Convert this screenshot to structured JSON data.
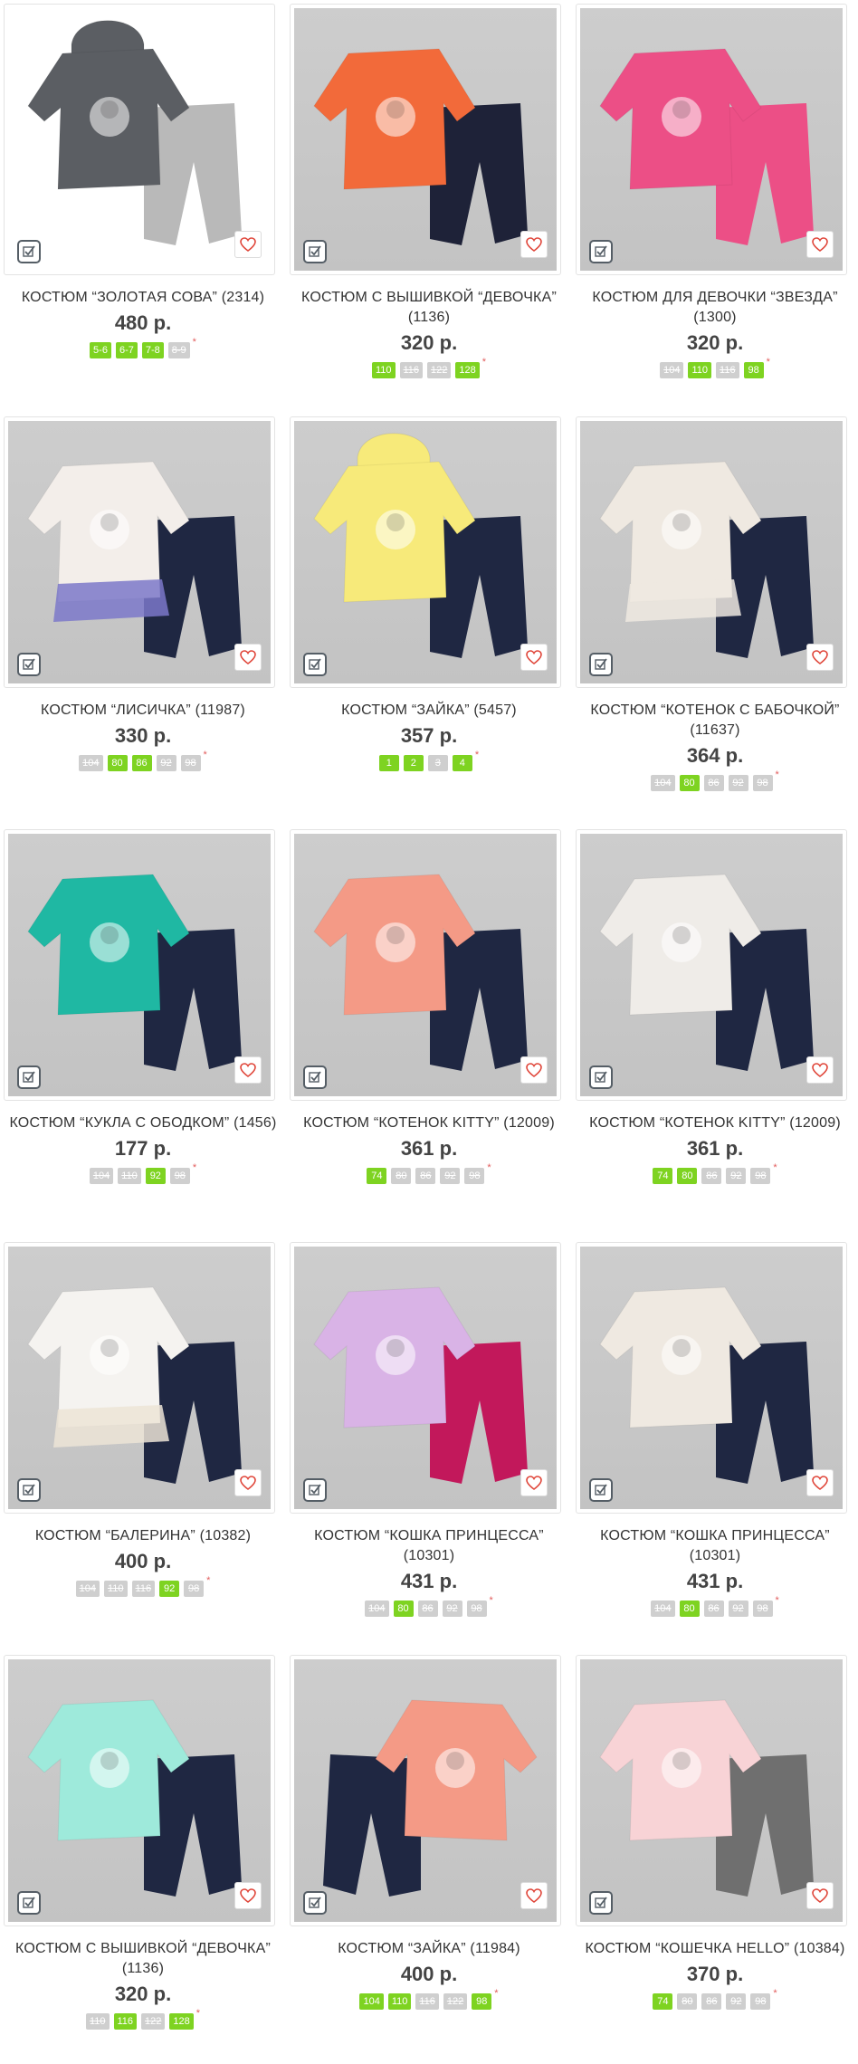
{
  "colors": {
    "accent_green": "#7ed321",
    "size_unavailable": "#cfcfcf",
    "heart": "#e0463a"
  },
  "icons": {
    "compare": "checkbox-check-icon",
    "favorite": "heart-icon"
  },
  "products": [
    {
      "title": "КОСТЮМ “ЗОЛОТАЯ СОВА” (2314)",
      "price": "480 р.",
      "sizes": [
        {
          "label": "5-6",
          "on": true
        },
        {
          "label": "6-7",
          "on": true
        },
        {
          "label": "7-8",
          "on": true
        },
        {
          "label": "8-9",
          "on": false
        }
      ]
    },
    {
      "title": "КОСТЮМ С ВЫШИВКОЙ “ДЕВОЧКА” (1136)",
      "price": "320 р.",
      "sizes": [
        {
          "label": "110",
          "on": true
        },
        {
          "label": "116",
          "on": false
        },
        {
          "label": "122",
          "on": false
        },
        {
          "label": "128",
          "on": true
        }
      ]
    },
    {
      "title": "КОСТЮМ ДЛЯ ДЕВОЧКИ “ЗВЕЗДА” (1300)",
      "price": "320 р.",
      "sizes": [
        {
          "label": "104",
          "on": false
        },
        {
          "label": "110",
          "on": true
        },
        {
          "label": "116",
          "on": false
        },
        {
          "label": "98",
          "on": true
        }
      ]
    },
    {
      "title": "КОСТЮМ “ЛИСИЧКА” (11987)",
      "price": "330 р.",
      "sizes": [
        {
          "label": "104",
          "on": false
        },
        {
          "label": "80",
          "on": true
        },
        {
          "label": "86",
          "on": true
        },
        {
          "label": "92",
          "on": false
        },
        {
          "label": "98",
          "on": false
        }
      ]
    },
    {
      "title": "КОСТЮМ “ЗАЙКА” (5457)",
      "price": "357 р.",
      "sizes": [
        {
          "label": "1",
          "on": true
        },
        {
          "label": "2",
          "on": true
        },
        {
          "label": "3",
          "on": false
        },
        {
          "label": "4",
          "on": true
        }
      ]
    },
    {
      "title": "КОСТЮМ “КОТЕНОК С БАБОЧКОЙ” (11637)",
      "price": "364 р.",
      "sizes": [
        {
          "label": "104",
          "on": false
        },
        {
          "label": "80",
          "on": true
        },
        {
          "label": "86",
          "on": false
        },
        {
          "label": "92",
          "on": false
        },
        {
          "label": "98",
          "on": false
        }
      ]
    },
    {
      "title": "КОСТЮМ “КУКЛА С ОБОДКОМ” (1456)",
      "price": "177 р.",
      "sizes": [
        {
          "label": "104",
          "on": false
        },
        {
          "label": "110",
          "on": false
        },
        {
          "label": "92",
          "on": true
        },
        {
          "label": "98",
          "on": false
        }
      ]
    },
    {
      "title": "КОСТЮМ “КОТЕНОК KITTY” (12009)",
      "price": "361 р.",
      "sizes": [
        {
          "label": "74",
          "on": true
        },
        {
          "label": "80",
          "on": false
        },
        {
          "label": "86",
          "on": false
        },
        {
          "label": "92",
          "on": false
        },
        {
          "label": "98",
          "on": false
        }
      ]
    },
    {
      "title": "КОСТЮМ “КОТЕНОК KITTY” (12009)",
      "price": "361 р.",
      "sizes": [
        {
          "label": "74",
          "on": true
        },
        {
          "label": "80",
          "on": true
        },
        {
          "label": "86",
          "on": false
        },
        {
          "label": "92",
          "on": false
        },
        {
          "label": "98",
          "on": false
        }
      ]
    },
    {
      "title": "КОСТЮМ “БАЛЕРИНА” (10382)",
      "price": "400 р.",
      "sizes": [
        {
          "label": "104",
          "on": false
        },
        {
          "label": "110",
          "on": false
        },
        {
          "label": "116",
          "on": false
        },
        {
          "label": "92",
          "on": true
        },
        {
          "label": "98",
          "on": false
        }
      ]
    },
    {
      "title": "КОСТЮМ “КОШКА ПРИНЦЕССА” (10301)",
      "price": "431 р.",
      "sizes": [
        {
          "label": "104",
          "on": false
        },
        {
          "label": "80",
          "on": true
        },
        {
          "label": "86",
          "on": false
        },
        {
          "label": "92",
          "on": false
        },
        {
          "label": "98",
          "on": false
        }
      ]
    },
    {
      "title": "КОСТЮМ “КОШКА ПРИНЦЕССА” (10301)",
      "price": "431 р.",
      "sizes": [
        {
          "label": "104",
          "on": false
        },
        {
          "label": "80",
          "on": true
        },
        {
          "label": "86",
          "on": false
        },
        {
          "label": "92",
          "on": false
        },
        {
          "label": "98",
          "on": false
        }
      ]
    },
    {
      "title": "КОСТЮМ С ВЫШИВКОЙ “ДЕВОЧКА” (1136)",
      "price": "320 р.",
      "sizes": [
        {
          "label": "110",
          "on": false
        },
        {
          "label": "116",
          "on": true
        },
        {
          "label": "122",
          "on": false
        },
        {
          "label": "128",
          "on": true
        }
      ]
    },
    {
      "title": "КОСТЮМ “ЗАЙКА” (11984)",
      "price": "400 р.",
      "sizes": [
        {
          "label": "104",
          "on": true
        },
        {
          "label": "110",
          "on": true
        },
        {
          "label": "116",
          "on": false
        },
        {
          "label": "122",
          "on": false
        },
        {
          "label": "98",
          "on": true
        }
      ]
    },
    {
      "title": "КОСТЮМ “КОШЕЧКА HELLO” (10384)",
      "price": "370 р.",
      "sizes": [
        {
          "label": "74",
          "on": true
        },
        {
          "label": "80",
          "on": false
        },
        {
          "label": "86",
          "on": false
        },
        {
          "label": "92",
          "on": false
        },
        {
          "label": "98",
          "on": false
        }
      ]
    }
  ]
}
